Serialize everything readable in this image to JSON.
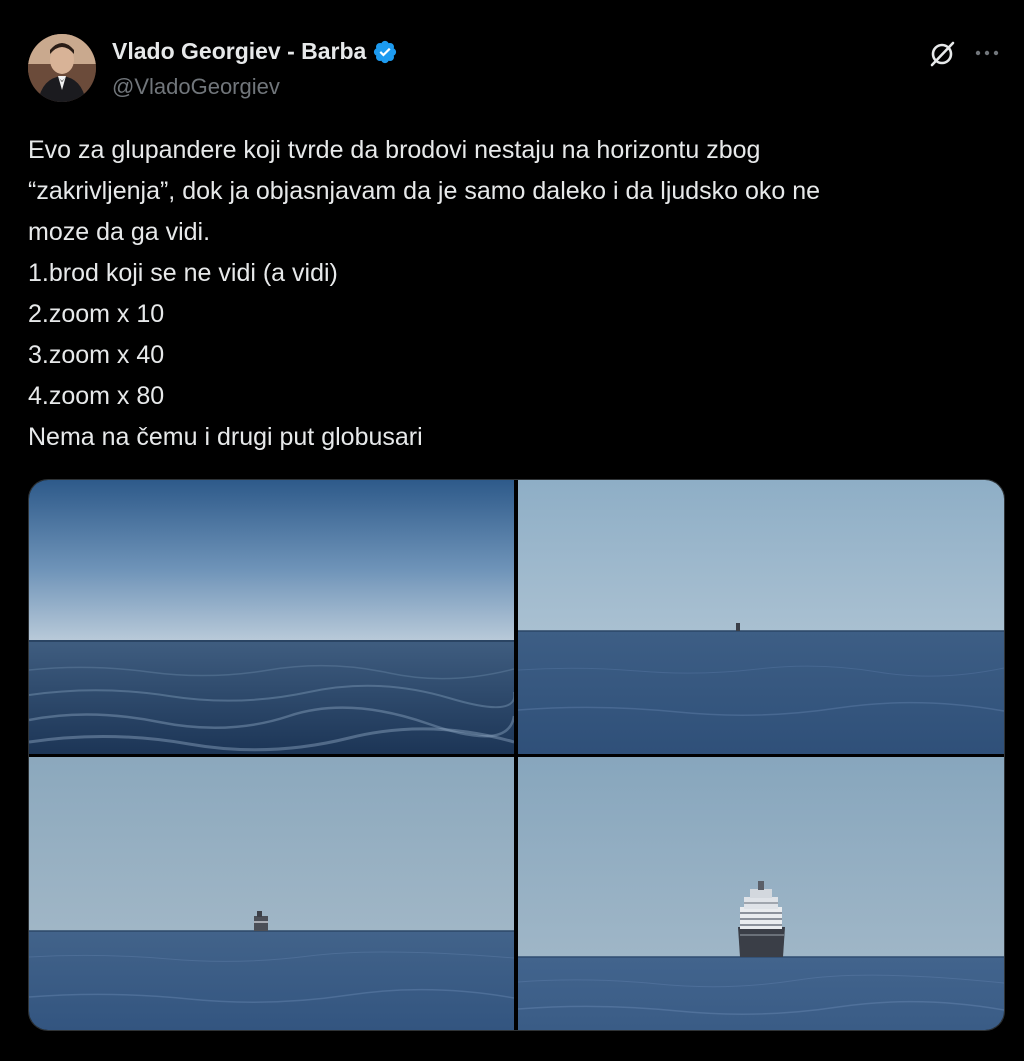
{
  "author": {
    "display_name": "Vlado Georgiev - Barba",
    "handle": "@VladoGeorgiev",
    "verified": true,
    "avatar_icon": "profile-photo-avatar"
  },
  "actions": {
    "grok_icon": "grok-icon",
    "more_icon": "more-options-icon"
  },
  "tweet": {
    "lines": [
      "Evo za glupandere koji tvrde da brodovi nestaju na horizontu zbog",
      "“zakrivljenja”, dok ja objasnjavam da je samo daleko i da ljudsko oko ne",
      "moze da ga vidi.",
      "1.brod koji se ne vidi (a vidi)",
      "2.zoom x 10",
      "3.zoom x 40",
      "4.zoom x 80",
      "Nema na čemu i drugi put globusari"
    ]
  },
  "media": {
    "photos": [
      {
        "subject": "sea-horizon-no-ship"
      },
      {
        "subject": "sea-horizon-tiny-ship"
      },
      {
        "subject": "sea-horizon-small-ship"
      },
      {
        "subject": "sea-horizon-cruise-ship"
      }
    ]
  },
  "colors": {
    "background": "#000000",
    "text": "#e7e9ea",
    "secondary_text": "#71767b",
    "verified_blue": "#1d9bf0"
  }
}
